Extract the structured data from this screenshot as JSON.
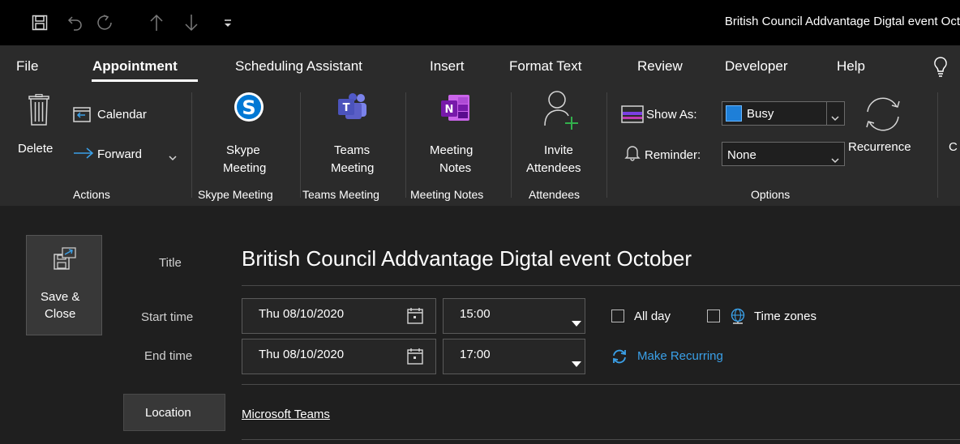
{
  "window": {
    "title": "British Council Addvantage Digtal event Oct"
  },
  "quick_access": {
    "icons": [
      "save-icon",
      "undo-icon",
      "redo-icon",
      "up-arrow-icon",
      "down-arrow-icon",
      "customize-icon"
    ]
  },
  "tabs": [
    {
      "label": "File"
    },
    {
      "label": "Appointment",
      "active": true
    },
    {
      "label": "Scheduling Assistant"
    },
    {
      "label": "Insert"
    },
    {
      "label": "Format Text"
    },
    {
      "label": "Review"
    },
    {
      "label": "Developer"
    },
    {
      "label": "Help"
    }
  ],
  "ribbon": {
    "actions": {
      "group_label": "Actions",
      "delete": "Delete",
      "calendar": "Calendar",
      "forward": "Forward"
    },
    "skype": {
      "group_label": "Skype Meeting",
      "line1": "Skype",
      "line2": "Meeting"
    },
    "teams": {
      "group_label": "Teams Meeting",
      "line1": "Teams",
      "line2": "Meeting"
    },
    "notes": {
      "group_label": "Meeting Notes",
      "line1": "Meeting",
      "line2": "Notes"
    },
    "attendees": {
      "group_label": "Attendees",
      "line1": "Invite",
      "line2": "Attendees"
    },
    "options": {
      "group_label": "Options",
      "show_as_label": "Show As:",
      "show_as_value": "Busy",
      "show_as_color": "#1e7fd8",
      "reminder_label": "Reminder:",
      "reminder_value": "None",
      "recurrence": "Recurrence",
      "cut_off": "C"
    }
  },
  "form": {
    "save_close": {
      "line1": "Save &",
      "line2": "Close"
    },
    "title_label": "Title",
    "title_value": "British Council Addvantage Digtal event October",
    "start": {
      "label": "Start time",
      "date": "Thu 08/10/2020",
      "time": "15:00"
    },
    "end": {
      "label": "End time",
      "date": "Thu 08/10/2020",
      "time": "17:00"
    },
    "all_day": "All day",
    "time_zones": "Time zones",
    "make_recurring": "Make Recurring",
    "location_button": "Location",
    "location_value": "Microsoft Teams"
  },
  "colors": {
    "accent_link": "#3aa0e8",
    "titlebar": "#000000",
    "ribbon": "#2b2b2b",
    "body": "#1f1f1f"
  }
}
